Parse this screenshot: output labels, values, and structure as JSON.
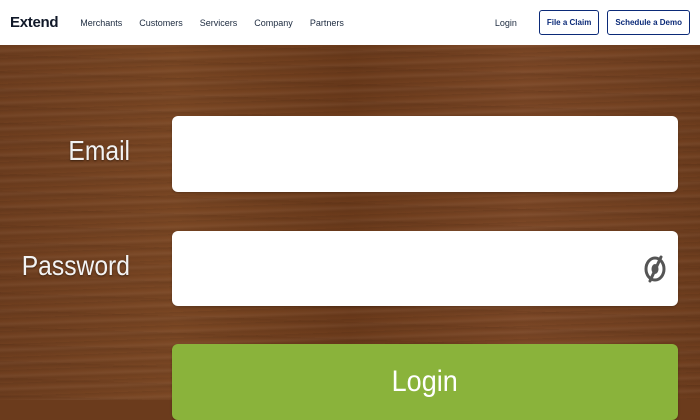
{
  "header": {
    "logo": "Extend",
    "nav": [
      "Merchants",
      "Customers",
      "Servicers",
      "Company",
      "Partners"
    ],
    "login_link": "Login",
    "file_claim": "File a Claim",
    "schedule_demo": "Schedule a Demo"
  },
  "form": {
    "email_label": "Email",
    "email_value": "",
    "password_label": "Password",
    "password_value": "",
    "login_button": "Login",
    "password_toggle_icon": "eye-slash-icon"
  },
  "colors": {
    "accent": "#0b2a78",
    "login_button": "#8ab33b",
    "background_wood": "#6e3e1f"
  }
}
